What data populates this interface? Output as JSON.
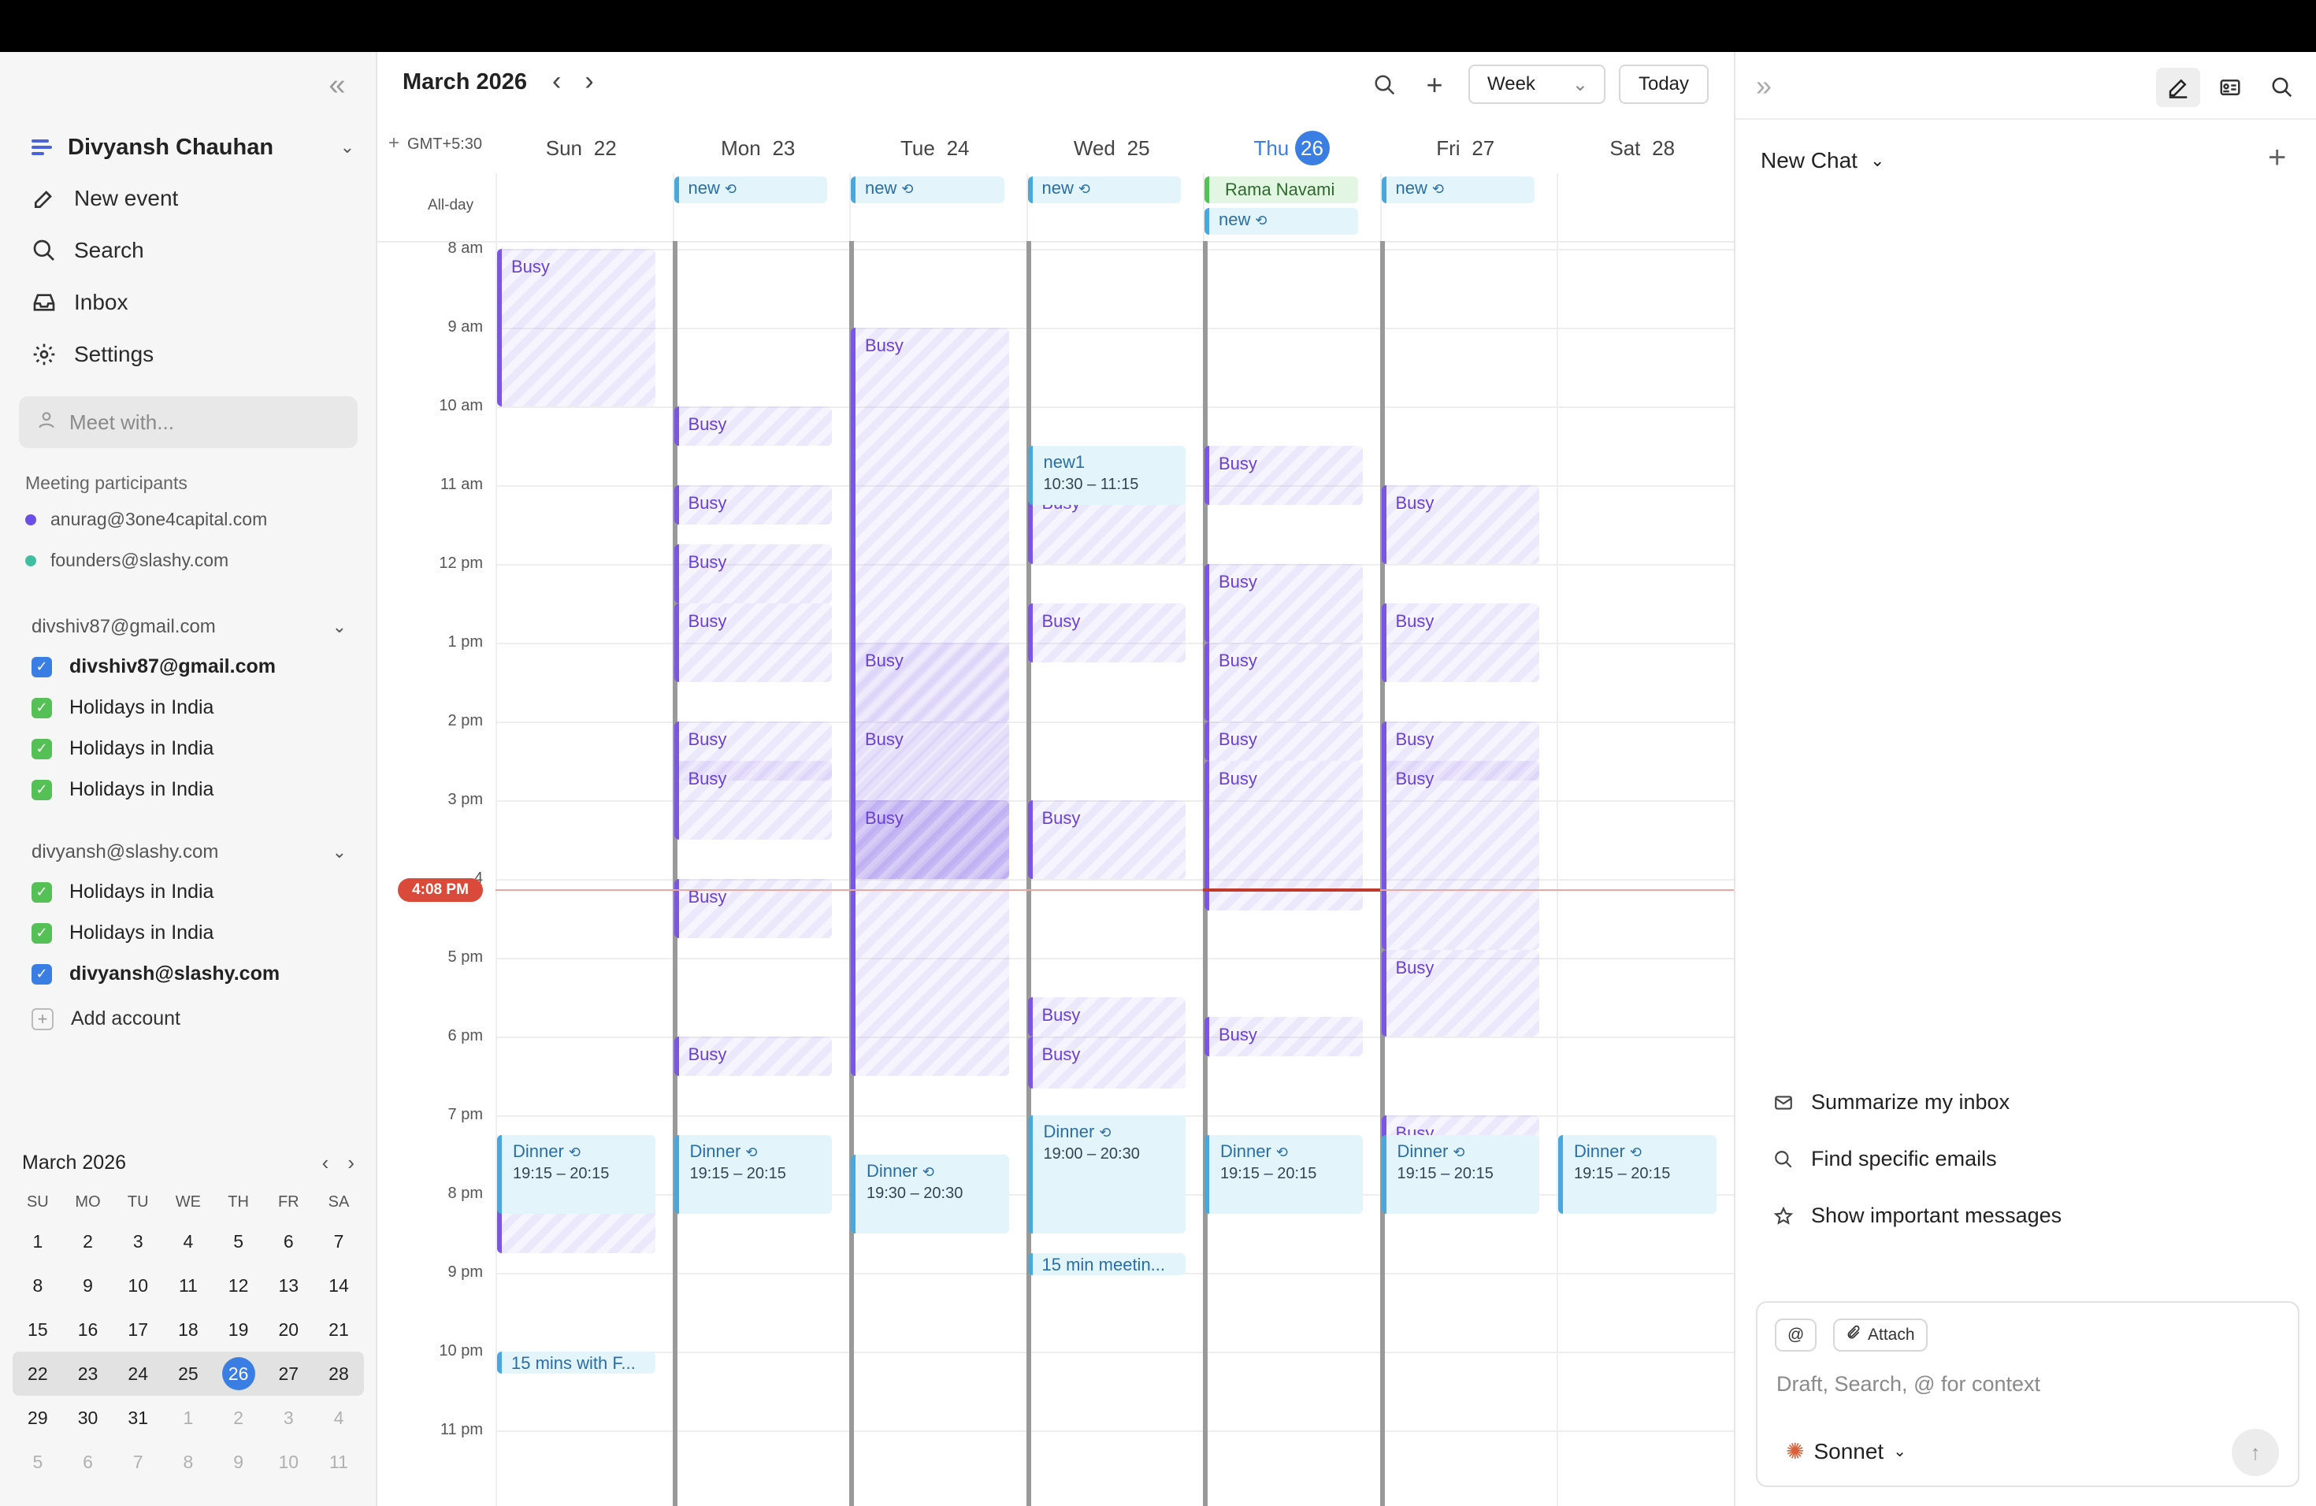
{
  "sidebar": {
    "user_name": "Divyansh Chauhan",
    "nav": {
      "new_event": "New event",
      "search": "Search",
      "inbox": "Inbox",
      "settings": "Settings"
    },
    "meet_placeholder": "Meet with...",
    "participants_label": "Meeting participants",
    "participants": [
      {
        "email": "anurag@3one4capital.com",
        "color": "#6b4ee6"
      },
      {
        "email": "founders@slashy.com",
        "color": "#3fbf9f"
      }
    ],
    "accounts": [
      {
        "name": "divshiv87@gmail.com",
        "calendars": [
          {
            "label": "divshiv87@gmail.com",
            "color": "#3b7ee3",
            "bold": true
          },
          {
            "label": "Holidays in India",
            "color": "#55c055"
          },
          {
            "label": "Holidays in India",
            "color": "#55c055"
          },
          {
            "label": "Holidays in India",
            "color": "#55c055"
          }
        ]
      },
      {
        "name": "divyansh@slashy.com",
        "calendars": [
          {
            "label": "Holidays in India",
            "color": "#55c055"
          },
          {
            "label": "Holidays in India",
            "color": "#55c055"
          },
          {
            "label": "divyansh@slashy.com",
            "color": "#3b7ee3",
            "bold": true
          }
        ]
      }
    ],
    "add_account": "Add account",
    "mini_calendar": {
      "title": "March 2026",
      "dows": [
        "SU",
        "MO",
        "TU",
        "WE",
        "TH",
        "FR",
        "SA"
      ],
      "weeks": [
        [
          "1",
          "2",
          "3",
          "4",
          "5",
          "6",
          "7"
        ],
        [
          "8",
          "9",
          "10",
          "11",
          "12",
          "13",
          "14"
        ],
        [
          "15",
          "16",
          "17",
          "18",
          "19",
          "20",
          "21"
        ],
        [
          "22",
          "23",
          "24",
          "25",
          "26",
          "27",
          "28"
        ],
        [
          "29",
          "30",
          "31",
          "1",
          "2",
          "3",
          "4"
        ],
        [
          "5",
          "6",
          "7",
          "8",
          "9",
          "10",
          "11"
        ]
      ],
      "today": "26"
    }
  },
  "calendar": {
    "month_title": "March 2026",
    "view": "Week",
    "today_label": "Today",
    "timezone": "GMT+5:30",
    "allday_label": "All-day",
    "days": [
      {
        "dow": "Sun",
        "num": "22"
      },
      {
        "dow": "Mon",
        "num": "23"
      },
      {
        "dow": "Tue",
        "num": "24"
      },
      {
        "dow": "Wed",
        "num": "25"
      },
      {
        "dow": "Thu",
        "num": "26",
        "today": true
      },
      {
        "dow": "Fri",
        "num": "27"
      },
      {
        "dow": "Sat",
        "num": "28"
      }
    ],
    "hours": [
      "8 am",
      "9 am",
      "10 am",
      "11 am",
      "12 pm",
      "1 pm",
      "2 pm",
      "3 pm",
      "4",
      "5 pm",
      "6 pm",
      "7 pm",
      "8 pm",
      "9 pm",
      "10 pm",
      "11 pm"
    ],
    "now_label": "4:08 PM",
    "now_time": 16.13,
    "allday_events": [
      {
        "day": 1,
        "title": "new",
        "type": "blue",
        "repeat": true,
        "row": 0
      },
      {
        "day": 2,
        "title": "new",
        "type": "blue",
        "repeat": true,
        "row": 0
      },
      {
        "day": 3,
        "title": "new",
        "type": "blue",
        "repeat": true,
        "row": 0
      },
      {
        "day": 4,
        "title": "Rama Navami",
        "type": "green",
        "row": 0
      },
      {
        "day": 4,
        "title": "new",
        "type": "blue",
        "repeat": true,
        "row": 1
      },
      {
        "day": 5,
        "title": "new",
        "type": "blue",
        "repeat": true,
        "row": 0
      }
    ],
    "events": [
      {
        "day": 0,
        "start": 8.0,
        "end": 10.0,
        "type": "busy",
        "title": "Busy"
      },
      {
        "day": 1,
        "start": 10.0,
        "end": 10.5,
        "type": "busy",
        "title": "Busy"
      },
      {
        "day": 1,
        "start": 11.0,
        "end": 11.5,
        "type": "busy",
        "title": "Busy"
      },
      {
        "day": 1,
        "start": 11.75,
        "end": 12.5,
        "type": "busy",
        "title": "Busy"
      },
      {
        "day": 1,
        "start": 12.5,
        "end": 13.5,
        "type": "busy",
        "title": "Busy"
      },
      {
        "day": 1,
        "start": 14.0,
        "end": 14.75,
        "type": "busy",
        "title": "Busy"
      },
      {
        "day": 1,
        "start": 14.5,
        "end": 15.5,
        "type": "busy",
        "title": "Busy"
      },
      {
        "day": 1,
        "start": 16.0,
        "end": 16.75,
        "type": "busy",
        "title": "Busy"
      },
      {
        "day": 1,
        "start": 18.0,
        "end": 18.5,
        "type": "busy",
        "title": "Busy"
      },
      {
        "day": 2,
        "start": 9.0,
        "end": 18.5,
        "type": "busy",
        "title": "Busy"
      },
      {
        "day": 2,
        "start": 13.0,
        "end": 14.0,
        "type": "busy",
        "title": "Busy"
      },
      {
        "day": 2,
        "start": 14.0,
        "end": 15.0,
        "type": "busy",
        "title": "Busy"
      },
      {
        "day": 2,
        "start": 15.0,
        "end": 16.0,
        "type": "busy",
        "title": "Busy",
        "dark": true
      },
      {
        "day": 3,
        "start": 11.0,
        "end": 12.0,
        "type": "busy",
        "title": "Busy"
      },
      {
        "day": 3,
        "start": 12.5,
        "end": 13.25,
        "type": "busy",
        "title": "Busy"
      },
      {
        "day": 3,
        "start": 15.0,
        "end": 16.0,
        "type": "busy",
        "title": "Busy"
      },
      {
        "day": 3,
        "start": 17.5,
        "end": 18.0,
        "type": "busy",
        "title": "Busy"
      },
      {
        "day": 3,
        "start": 18.0,
        "end": 18.66,
        "type": "busy",
        "title": "Busy"
      },
      {
        "day": 4,
        "start": 10.5,
        "end": 11.25,
        "type": "busy",
        "title": "Busy"
      },
      {
        "day": 4,
        "start": 12.0,
        "end": 13.0,
        "type": "busy",
        "title": "Busy"
      },
      {
        "day": 4,
        "start": 13.0,
        "end": 14.0,
        "type": "busy",
        "title": "Busy"
      },
      {
        "day": 4,
        "start": 14.0,
        "end": 14.5,
        "type": "busy",
        "title": "Busy"
      },
      {
        "day": 4,
        "start": 14.5,
        "end": 16.4,
        "type": "busy",
        "title": "Busy"
      },
      {
        "day": 4,
        "start": 17.75,
        "end": 18.25,
        "type": "busy",
        "title": "Busy"
      },
      {
        "day": 5,
        "start": 11.0,
        "end": 12.0,
        "type": "busy",
        "title": "Busy"
      },
      {
        "day": 5,
        "start": 12.5,
        "end": 13.5,
        "type": "busy",
        "title": "Busy"
      },
      {
        "day": 5,
        "start": 14.0,
        "end": 14.75,
        "type": "busy",
        "title": "Busy"
      },
      {
        "day": 5,
        "start": 14.5,
        "end": 16.9,
        "type": "busy",
        "title": "Busy"
      },
      {
        "day": 5,
        "start": 16.9,
        "end": 18.0,
        "type": "busy",
        "title": "Busy"
      },
      {
        "day": 5,
        "start": 19.0,
        "end": 19.3,
        "type": "busy",
        "title": "Busy"
      },
      {
        "day": 0,
        "start": 19.25,
        "end": 20.75,
        "type": "busy",
        "title": ""
      },
      {
        "day": 3,
        "start": 10.5,
        "end": 11.25,
        "type": "blue",
        "title": "new1",
        "time": "10:30 – 11:15"
      },
      {
        "day": 0,
        "start": 19.25,
        "end": 20.25,
        "type": "blue",
        "title": "Dinner",
        "time": "19:15 – 20:15",
        "repeat": true
      },
      {
        "day": 1,
        "start": 19.25,
        "end": 20.25,
        "type": "blue",
        "title": "Dinner",
        "time": "19:15 – 20:15",
        "repeat": true
      },
      {
        "day": 2,
        "start": 19.5,
        "end": 20.5,
        "type": "blue",
        "title": "Dinner",
        "time": "19:30 – 20:30",
        "repeat": true
      },
      {
        "day": 3,
        "start": 19.0,
        "end": 20.5,
        "type": "blue",
        "title": "Dinner",
        "time": "19:00 – 20:30",
        "repeat": true
      },
      {
        "day": 4,
        "start": 19.25,
        "end": 20.25,
        "type": "blue",
        "title": "Dinner",
        "time": "19:15 – 20:15",
        "repeat": true
      },
      {
        "day": 5,
        "start": 19.25,
        "end": 20.25,
        "type": "blue",
        "title": "Dinner",
        "time": "19:15 – 20:15",
        "repeat": true
      },
      {
        "day": 6,
        "start": 19.25,
        "end": 20.25,
        "type": "blue",
        "title": "Dinner",
        "time": "19:15 – 20:15",
        "repeat": true
      },
      {
        "day": 3,
        "start": 20.75,
        "end": 21.0,
        "type": "pill",
        "title": "15 min meetin..."
      },
      {
        "day": 0,
        "start": 22.0,
        "end": 22.25,
        "type": "pill",
        "title": "15 mins with F..."
      }
    ],
    "busy_rails": [
      1,
      2,
      3,
      4,
      5
    ]
  },
  "chat": {
    "title": "New Chat",
    "suggestions": [
      {
        "label": "Summarize my inbox",
        "icon": "mail-icon"
      },
      {
        "label": "Find specific emails",
        "icon": "search-icon"
      },
      {
        "label": "Show important messages",
        "icon": "star-icon"
      }
    ],
    "mention_chip": "@",
    "attach_chip": "Attach",
    "placeholder": "Draft, Search, @ for context",
    "model": "Sonnet"
  }
}
